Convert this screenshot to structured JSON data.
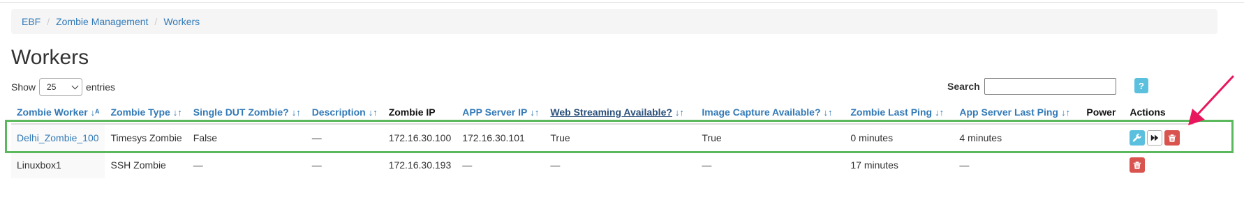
{
  "breadcrumb": {
    "items": [
      "EBF",
      "Zombie Management",
      "Workers"
    ],
    "separator": "/"
  },
  "page": {
    "title": "Workers"
  },
  "length_menu": {
    "prefix": "Show",
    "selected": "25",
    "suffix": "entries"
  },
  "search": {
    "label": "Search",
    "value": ""
  },
  "help": {
    "label": "?"
  },
  "table": {
    "columns": [
      {
        "label": "Zombie Worker",
        "sort_icon": "↓ᴬ",
        "sortable": true
      },
      {
        "label": "Zombie Type",
        "sort_icon": "↓↑",
        "sortable": true
      },
      {
        "label": "Single DUT Zombie?",
        "sort_icon": "↓↑",
        "sortable": true
      },
      {
        "label": "Description",
        "sort_icon": "↓↑",
        "sortable": true
      },
      {
        "label": "Zombie IP",
        "sort_icon": "",
        "sortable": false
      },
      {
        "label": "APP Server IP",
        "sort_icon": "↓↑",
        "sortable": true
      },
      {
        "label": "Web Streaming Available?",
        "sort_icon": "↓↑",
        "sortable": true
      },
      {
        "label": "Image Capture Available?",
        "sort_icon": "↓↑",
        "sortable": true
      },
      {
        "label": "Zombie Last Ping",
        "sort_icon": "↓↑",
        "sortable": true
      },
      {
        "label": "App Server Last Ping",
        "sort_icon": "↓↑",
        "sortable": true
      },
      {
        "label": "Power",
        "sort_icon": "",
        "sortable": false
      },
      {
        "label": "Actions",
        "sort_icon": "",
        "sortable": false
      }
    ],
    "rows": [
      {
        "worker": "Delhi_Zombie_100",
        "type": "Timesys Zombie",
        "single_dut": "False",
        "description": "—",
        "zombie_ip": "172.16.30.100",
        "app_server_ip": "172.16.30.101",
        "web_streaming": "True",
        "image_capture": "True",
        "zombie_last_ping": "0 minutes",
        "app_server_last_ping": "4 minutes",
        "power": "",
        "actions": [
          "wrench-icon",
          "fast-forward-icon",
          "trash-icon"
        ]
      },
      {
        "worker": "Linuxbox1",
        "type": "SSH Zombie",
        "single_dut": "—",
        "description": "—",
        "zombie_ip": "172.16.30.193",
        "app_server_ip": "—",
        "web_streaming": "—",
        "image_capture": "—",
        "zombie_last_ping": "17 minutes",
        "app_server_last_ping": "—",
        "power": "",
        "actions": [
          "trash-icon"
        ]
      }
    ]
  },
  "colors": {
    "link": "#337ab7",
    "info": "#5bc0de",
    "danger": "#d9534f",
    "highlight": "#5cb85c",
    "arrow": "#e8175d",
    "breadcrumb_bg": "#f5f5f5"
  }
}
